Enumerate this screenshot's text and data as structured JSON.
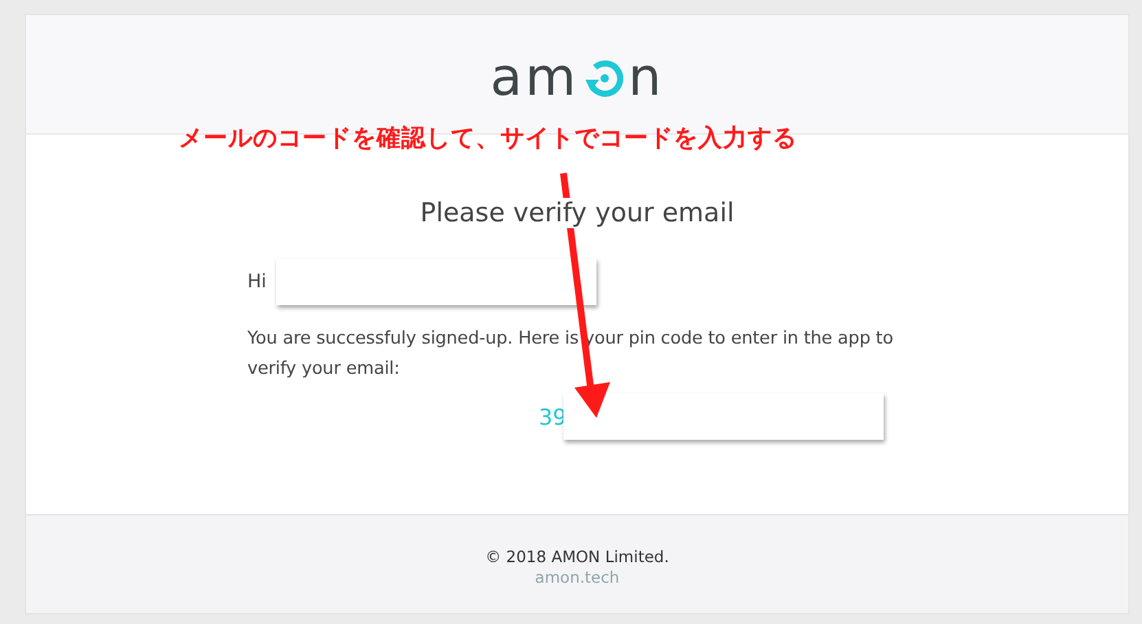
{
  "logo": {
    "start": "am",
    "end": "n"
  },
  "annotation": {
    "text": "メールのコードを確認して、サイトでコードを入力する"
  },
  "title": "Please verify your email",
  "greeting": "Hi",
  "message": "You are successfuly signed-up. Here is your pin code to enter in the app to verify your email:",
  "pin_code": "39",
  "footer": {
    "copyright": "© 2018 AMON Limited.",
    "link": "amon.tech"
  }
}
